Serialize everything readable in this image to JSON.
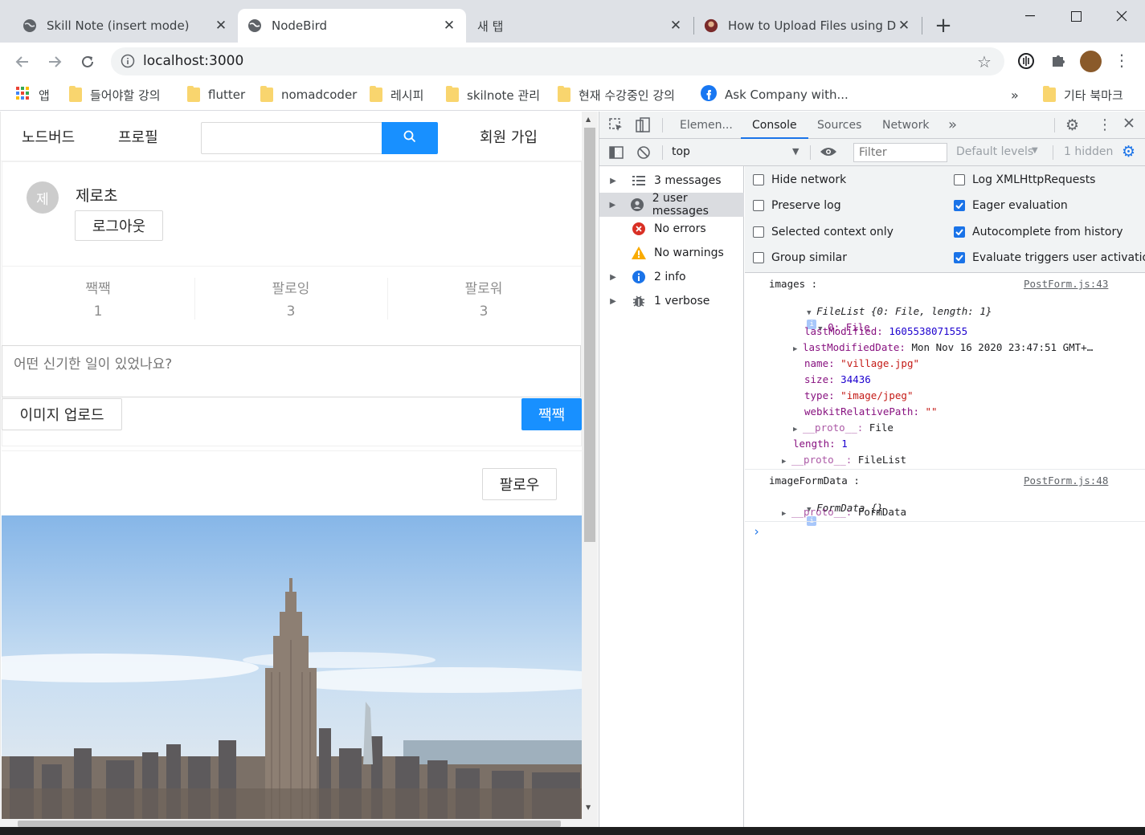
{
  "browser": {
    "tabs": [
      {
        "title": "Skill Note (insert mode)"
      },
      {
        "title": "NodeBird"
      },
      {
        "title": "새 탭"
      },
      {
        "title": "How to Upload Files using DF"
      }
    ],
    "url": "localhost:3000",
    "bookmarks": [
      "앱",
      "들어야할 강의",
      "flutter",
      "nomadcoder",
      "레시피",
      "skilnote 관리",
      "현재 수강중인 강의",
      "Ask Company with...",
      "기타 북마크"
    ]
  },
  "nodebird": {
    "menu": {
      "home": "노드버드",
      "profile": "프로필",
      "signup": "회원 가입"
    },
    "user": {
      "avatar": "제",
      "nickname": "제로초",
      "logout": "로그아웃"
    },
    "stats": [
      {
        "label": "짹짹",
        "value": "1"
      },
      {
        "label": "팔로잉",
        "value": "3"
      },
      {
        "label": "팔로워",
        "value": "3"
      }
    ],
    "post_form": {
      "placeholder": "어떤 신기한 일이 있었나요?",
      "upload": "이미지 업로드",
      "submit": "짹짹"
    },
    "follow_button": "팔로우"
  },
  "devtools": {
    "tabs": [
      "Elemen...",
      "Console",
      "Sources",
      "Network"
    ],
    "context": "top",
    "filter_placeholder": "Filter",
    "levels": "Default levels",
    "hidden": "1 hidden",
    "sidebar": [
      {
        "label": "3 messages",
        "icon": "list-icon"
      },
      {
        "label": "2 user messages",
        "icon": "user-icon"
      },
      {
        "label": "No errors",
        "icon": "error-icon"
      },
      {
        "label": "No warnings",
        "icon": "warning-icon"
      },
      {
        "label": "2 info",
        "icon": "info-icon"
      },
      {
        "label": "1 verbose",
        "icon": "bug-icon"
      }
    ],
    "settings": {
      "left": [
        {
          "label": "Hide network",
          "checked": false
        },
        {
          "label": "Preserve log",
          "checked": false
        },
        {
          "label": "Selected context only",
          "checked": false
        },
        {
          "label": "Group similar",
          "checked": false
        }
      ],
      "right": [
        {
          "label": "Log XMLHttpRequests",
          "checked": false
        },
        {
          "label": "Eager evaluation",
          "checked": true
        },
        {
          "label": "Autocomplete from history",
          "checked": true
        },
        {
          "label": "Evaluate triggers user activation",
          "checked": true
        }
      ]
    },
    "console": {
      "log1_label": "images :",
      "log1_source": "PostForm.js:43",
      "filelist_summary": "FileList {0: File, length: 1}",
      "file_index": "0: File",
      "last_modified_key": "lastModified:",
      "last_modified_val": "1605538071555",
      "last_modified_date_key": "lastModifiedDate:",
      "last_modified_date_val": "Mon Nov 16 2020 23:47:51 GMT+…",
      "name_key": "name:",
      "name_val": "\"village.jpg\"",
      "size_key": "size:",
      "size_val": "34436",
      "type_key": "type:",
      "type_val": "\"image/jpeg\"",
      "wrp_key": "webkitRelativePath:",
      "wrp_val": "\"\"",
      "proto_file": "File",
      "length_key": "length:",
      "length_val": "1",
      "proto_filelist": "FileList",
      "proto_key": "__proto__:",
      "log2_label": "imageFormData :",
      "log2_source": "PostForm.js:48",
      "formdata_summary": "FormData {}",
      "proto_formdata": "FormData"
    }
  },
  "colors": {
    "primary": "#1890ff",
    "devtools_blue": "#1a73e8"
  }
}
